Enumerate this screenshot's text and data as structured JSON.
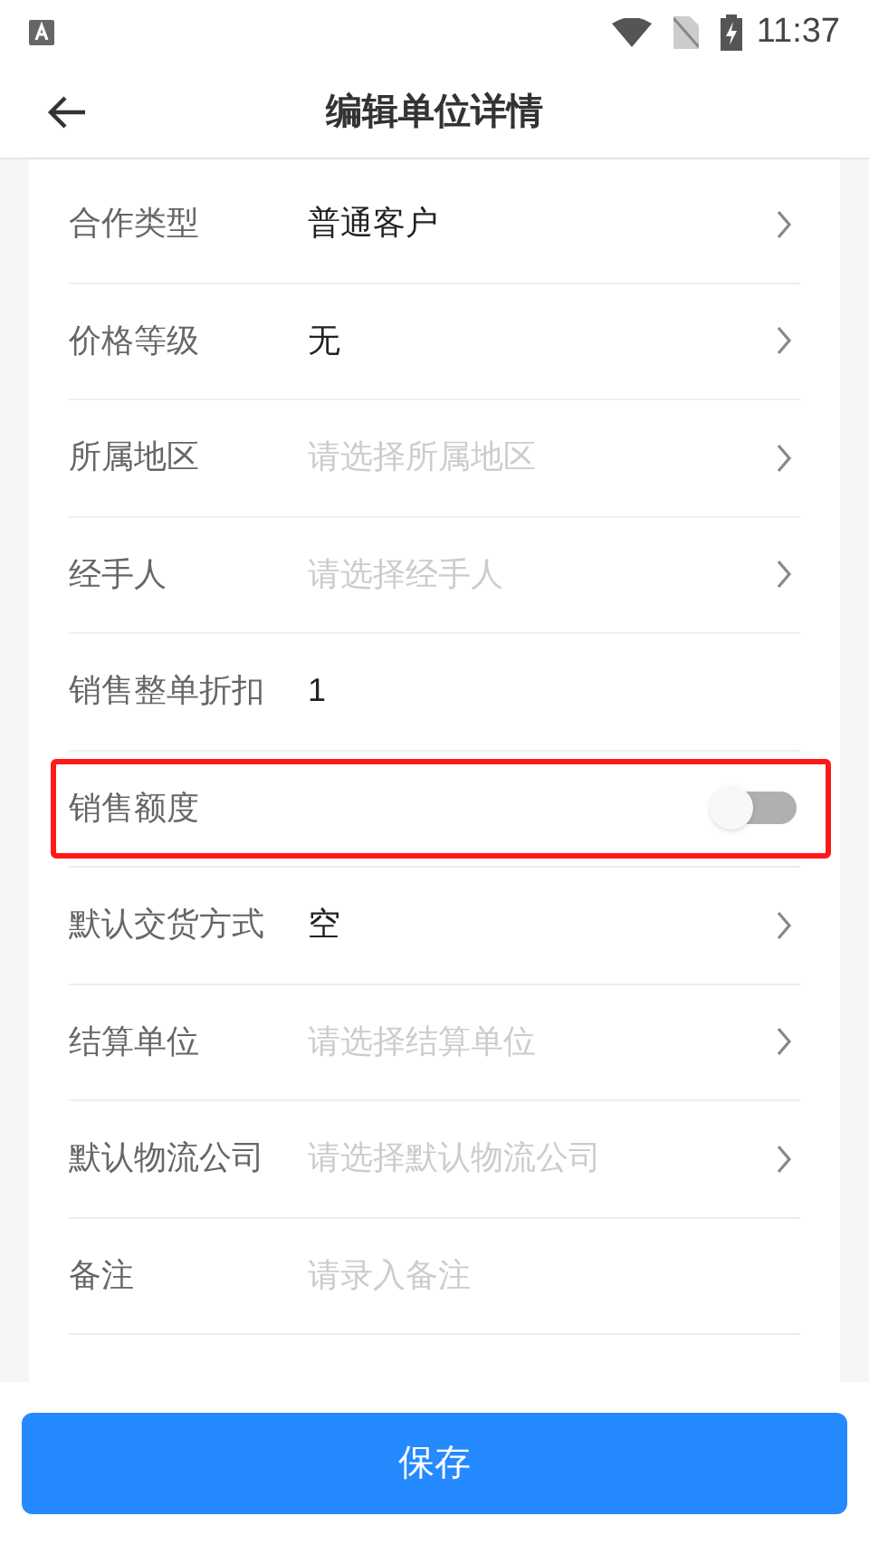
{
  "status_bar": {
    "time": "11:37"
  },
  "header": {
    "title": "编辑单位详情"
  },
  "fields": [
    {
      "kind": "select",
      "label": "合作类型",
      "value": "普通客户",
      "highlighted": false
    },
    {
      "kind": "select",
      "label": "价格等级",
      "value": "无",
      "highlighted": false
    },
    {
      "kind": "select",
      "label": "所属地区",
      "placeholder": "请选择所属地区",
      "highlighted": false
    },
    {
      "kind": "select",
      "label": "经手人",
      "placeholder": "请选择经手人",
      "highlighted": false
    },
    {
      "kind": "text",
      "label": "销售整单折扣",
      "value": "1",
      "highlighted": false
    },
    {
      "kind": "toggle",
      "label": "销售额度",
      "on": false,
      "highlighted": true
    },
    {
      "kind": "select",
      "label": "默认交货方式",
      "value": "空",
      "highlighted": false
    },
    {
      "kind": "select",
      "label": "结算单位",
      "placeholder": "请选择结算单位",
      "highlighted": false
    },
    {
      "kind": "select",
      "label": "默认物流公司",
      "placeholder": "请选择默认物流公司",
      "highlighted": false
    },
    {
      "kind": "text",
      "label": "备注",
      "placeholder": "请录入备注",
      "highlighted": false
    }
  ],
  "save_button": {
    "label": "保存"
  }
}
